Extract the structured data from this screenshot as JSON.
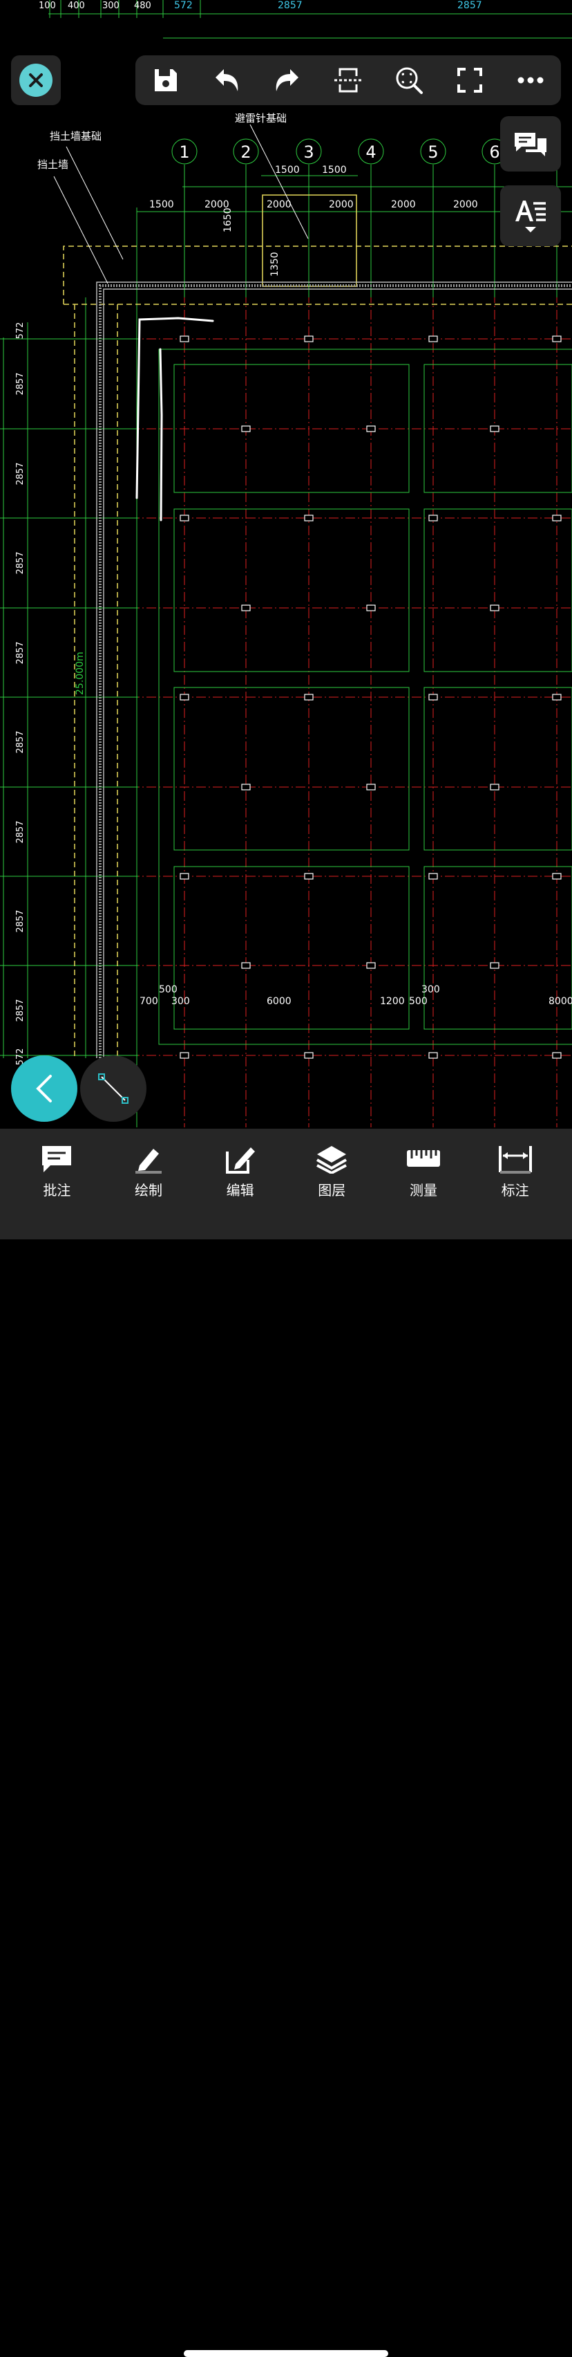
{
  "drawing": {
    "top_dims": [
      "100",
      "400",
      "300",
      "480",
      "572",
      "2857",
      "2857"
    ],
    "axis_labels": [
      "1",
      "2",
      "3",
      "4",
      "5",
      "6"
    ],
    "dims_row1": [
      "1500",
      "1500"
    ],
    "dims_row2": [
      "1500",
      "2000",
      "2000",
      "2000",
      "2000",
      "2000"
    ],
    "dim_v1": "1650",
    "dim_v2": "1350",
    "annotations": {
      "retaining_foundation": "挡土墙基础",
      "retaining_wall": "挡土墙",
      "lightning": "避雷针基础"
    },
    "left_dims": [
      "572",
      "2857",
      "2857",
      "2857",
      "2857",
      "2857",
      "2857",
      "2857",
      "2857",
      "572"
    ],
    "left_mid": "25.000m",
    "bottom_dims": [
      "700",
      "500",
      "300",
      "6000",
      "1200",
      "500",
      "300",
      "8000"
    ]
  },
  "toolbar": {
    "icons": [
      "save-icon",
      "undo-icon",
      "redo-icon",
      "section-icon",
      "zoom-window-icon",
      "fullscreen-icon",
      "more-icon"
    ]
  },
  "bottom_tabs": [
    {
      "label": "批注",
      "icon": "comment-icon"
    },
    {
      "label": "绘制",
      "icon": "pencil-icon"
    },
    {
      "label": "编辑",
      "icon": "edit-icon"
    },
    {
      "label": "图层",
      "icon": "layers-icon"
    },
    {
      "label": "测量",
      "icon": "ruler-icon"
    },
    {
      "label": "标注",
      "icon": "dimension-icon"
    }
  ],
  "colors": {
    "accent": "#2cbfc7",
    "close": "#5ecfd3",
    "cad_green": "#2ecc40",
    "cad_red": "#e02020",
    "cad_cyan": "#3fc8e8",
    "cad_yellow": "#e6d85a"
  }
}
